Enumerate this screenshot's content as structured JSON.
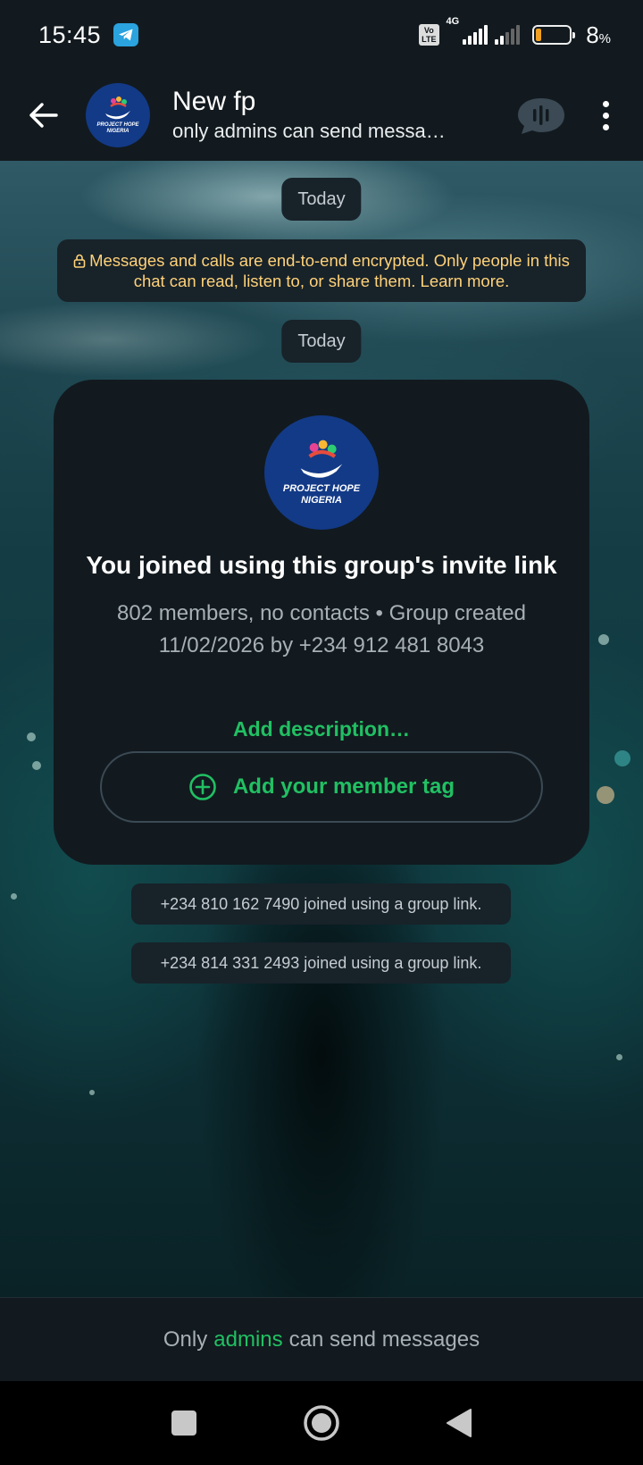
{
  "status_bar": {
    "time": "15:45",
    "volte": "Vo LTE",
    "network": "4G",
    "battery_percent": "8",
    "battery_unit": "%",
    "battery_level": 0.08,
    "icons": [
      "telegram-icon",
      "signal-icon",
      "battery-icon"
    ]
  },
  "header": {
    "title": "New fp",
    "subtitle": "only admins can send messa…",
    "avatar_text_line1": "PROJECT HOPE",
    "avatar_text_line2": "NIGERIA"
  },
  "chat": {
    "date_chip_1": "Today",
    "encryption_notice": "Messages and calls are end-to-end encrypted. Only people in this chat can read, listen to, or share them. Learn more.",
    "date_chip_2": "Today",
    "group_card": {
      "avatar_text_line1": "PROJECT HOPE",
      "avatar_text_line2": "NIGERIA",
      "title": "You joined using this group's invite link",
      "info": "802 members, no contacts • Group created 11/02/2026 by +234 912 481 8043",
      "add_description": "Add description…",
      "member_tag_button": "Add your member tag"
    },
    "system_messages": [
      "+234 810 162 7490 joined using a group link.",
      "+234 814 331 2493 joined using a group link."
    ]
  },
  "footer": {
    "prefix": "Only",
    "admins": "admins",
    "suffix": "can send messages"
  },
  "colors": {
    "accent_green": "#21c063",
    "encryption_yellow": "#ffd279",
    "panel": "#121a1f",
    "chip": "#182229",
    "avatar_blue": "#133a87"
  }
}
